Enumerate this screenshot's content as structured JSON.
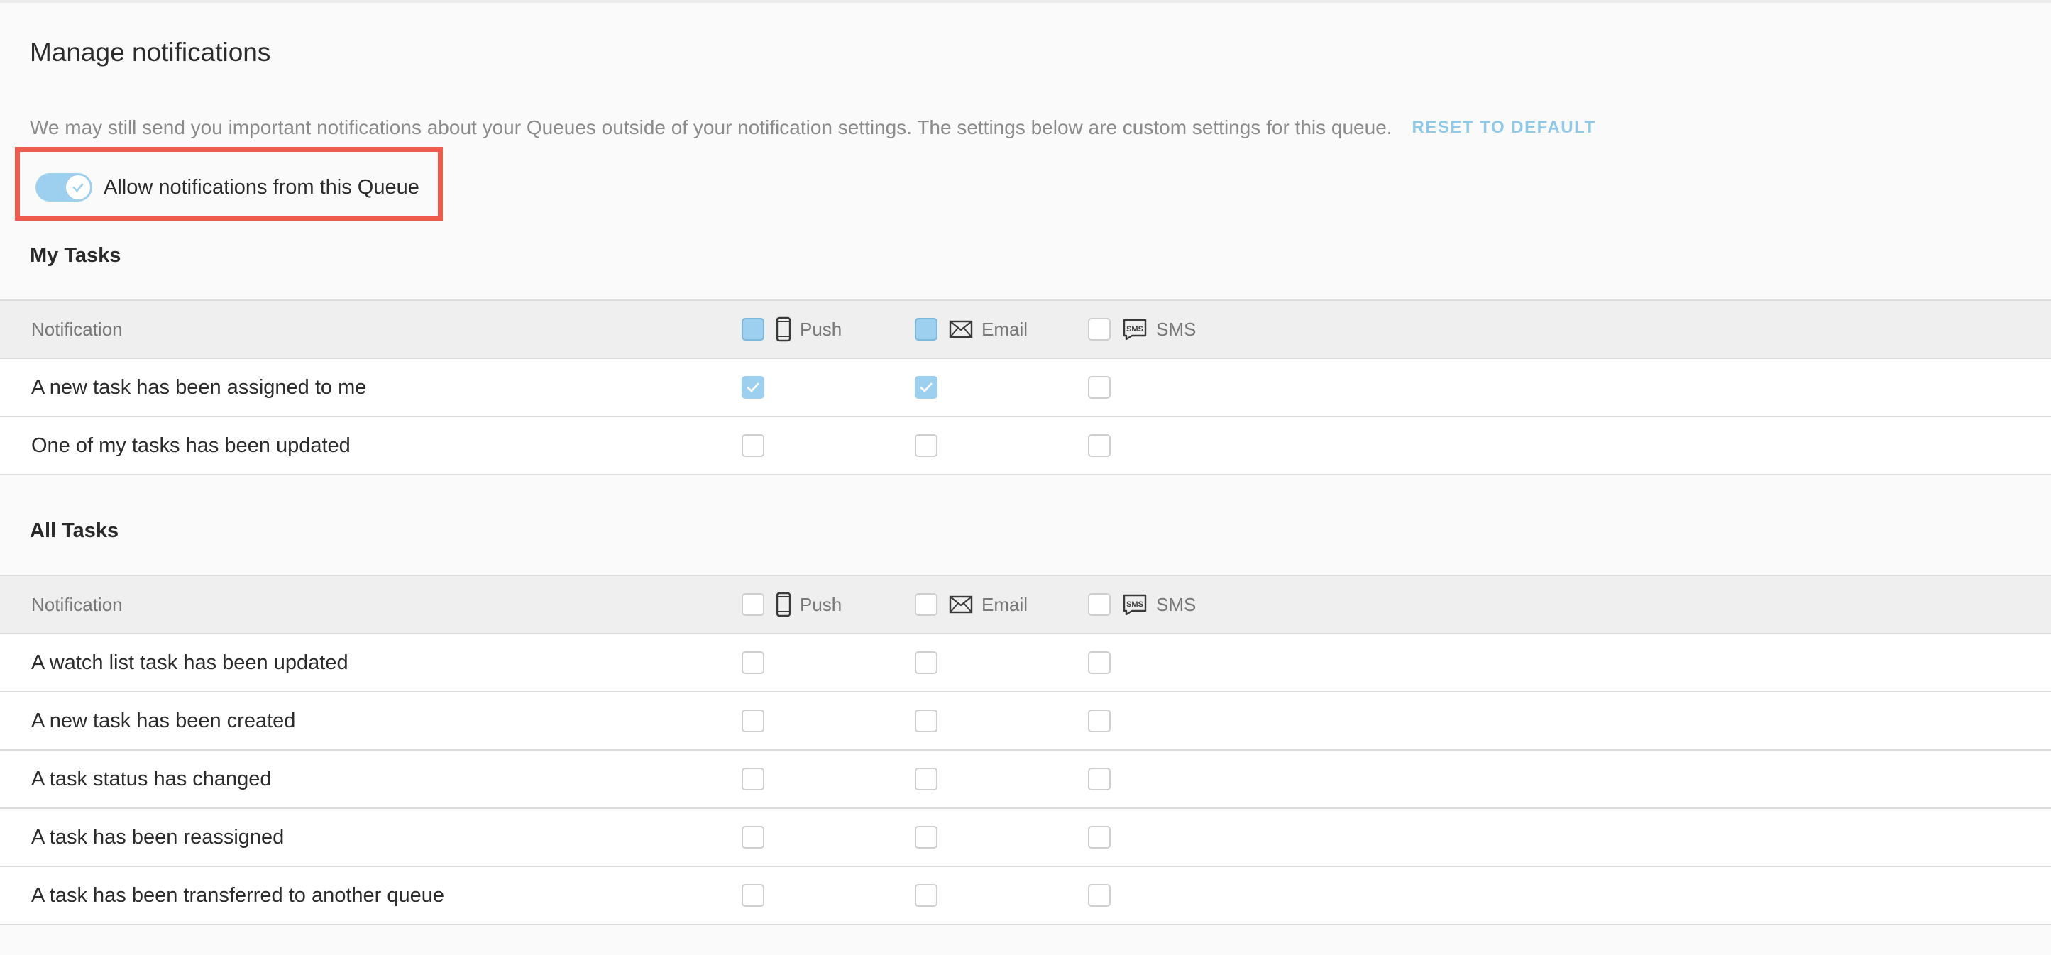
{
  "title": "Manage notifications",
  "intro": "We may still send you important notifications about your Queues outside of your notification settings. The settings below are custom settings for this queue.",
  "reset_label": "RESET TO DEFAULT",
  "allow": {
    "label": "Allow notifications from this Queue",
    "enabled": true
  },
  "colors": {
    "accent": "#9dcfee",
    "highlight_border": "#ee5b4f",
    "link": "#8ec9ea"
  },
  "channels": [
    {
      "label": "Push",
      "icon": "phone-icon"
    },
    {
      "label": "Email",
      "icon": "envelope-icon"
    },
    {
      "label": "SMS",
      "icon": "sms-icon"
    }
  ],
  "sections": {
    "my_tasks": {
      "title": "My Tasks",
      "header": "Notification",
      "header_state": [
        "filled",
        "filled",
        "empty"
      ],
      "rows": [
        {
          "label": "A new task has been assigned to me",
          "push": true,
          "email": true,
          "sms": false
        },
        {
          "label": "One of my tasks has been updated",
          "push": false,
          "email": false,
          "sms": false
        }
      ]
    },
    "all_tasks": {
      "title": "All Tasks",
      "header": "Notification",
      "header_state": [
        "empty",
        "empty",
        "empty"
      ],
      "rows": [
        {
          "label": "A watch list task has been updated",
          "push": false,
          "email": false,
          "sms": false
        },
        {
          "label": "A new task has been created",
          "push": false,
          "email": false,
          "sms": false
        },
        {
          "label": "A task status has changed",
          "push": false,
          "email": false,
          "sms": false
        },
        {
          "label": "A task has been reassigned",
          "push": false,
          "email": false,
          "sms": false
        },
        {
          "label": "A task has been transferred to another queue",
          "push": false,
          "email": false,
          "sms": false
        }
      ]
    }
  }
}
